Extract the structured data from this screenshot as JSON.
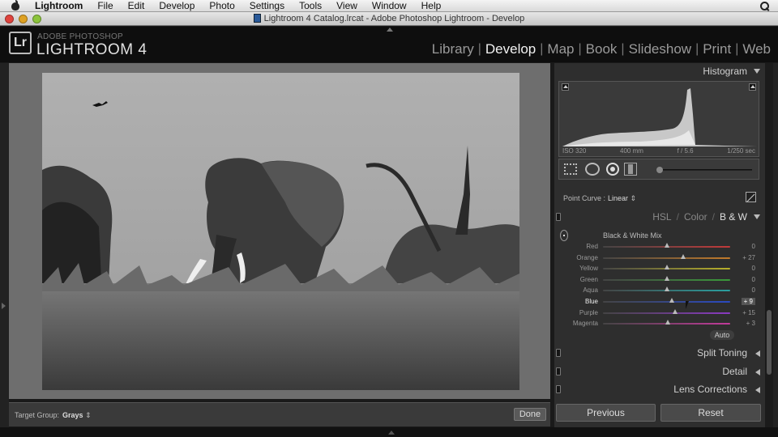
{
  "menubar": {
    "app": "Lightroom",
    "items": [
      "File",
      "Edit",
      "Develop",
      "Photo",
      "Settings",
      "Tools",
      "View",
      "Window",
      "Help"
    ]
  },
  "window": {
    "title": "Lightroom 4 Catalog.lrcat - Adobe Photoshop Lightroom - Develop"
  },
  "header": {
    "logo": "Lr",
    "brand_small": "ADOBE PHOTOSHOP",
    "brand_big": "LIGHTROOM 4",
    "modules": [
      "Library",
      "Develop",
      "Map",
      "Book",
      "Slideshow",
      "Print",
      "Web"
    ],
    "active_module": "Develop"
  },
  "toolbar": {
    "target_group_label": "Target Group:",
    "target_group_value": "Grays",
    "done_label": "Done"
  },
  "histogram": {
    "title": "Histogram",
    "iso": "ISO 320",
    "focal": "400 mm",
    "aperture": "f / 5.6",
    "shutter": "1/250 sec"
  },
  "point_curve": {
    "label": "Point Curve :",
    "value": "Linear"
  },
  "hsl": {
    "tabs": [
      "HSL",
      "Color",
      "B & W"
    ],
    "active": "B & W"
  },
  "bw_mix": {
    "title": "Black & White Mix",
    "sliders": [
      {
        "name": "Red",
        "value": "0",
        "position": 0.5,
        "color": "#c23a3a"
      },
      {
        "name": "Orange",
        "value": "+ 27",
        "position": 0.63,
        "color": "#c27a2a"
      },
      {
        "name": "Yellow",
        "value": "0",
        "position": 0.5,
        "color": "#b8b02a"
      },
      {
        "name": "Green",
        "value": "0",
        "position": 0.5,
        "color": "#3a9a3a"
      },
      {
        "name": "Aqua",
        "value": "0",
        "position": 0.5,
        "color": "#2aa0a0"
      },
      {
        "name": "Blue",
        "value": "+ 9",
        "position": 0.54,
        "color": "#2a4ac2"
      },
      {
        "name": "Purple",
        "value": "+ 15",
        "position": 0.57,
        "color": "#8a3ac2"
      },
      {
        "name": "Magenta",
        "value": "+ 3",
        "position": 0.51,
        "color": "#c23a9a"
      }
    ],
    "active_slider": "Blue",
    "auto_label": "Auto"
  },
  "panels": {
    "split_toning": "Split Toning",
    "detail": "Detail",
    "lens_corrections": "Lens Corrections"
  },
  "buttons": {
    "previous": "Previous",
    "reset": "Reset"
  }
}
